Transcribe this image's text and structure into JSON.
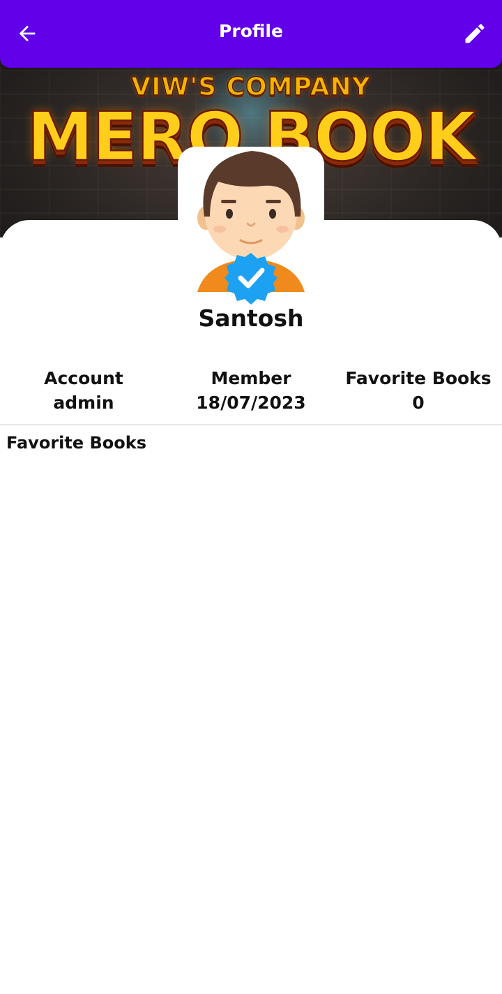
{
  "appbar": {
    "title": "Profile",
    "back_icon": "arrow-back-icon",
    "edit_icon": "pencil-edit-icon",
    "background": "#6200ea"
  },
  "banner": {
    "company": "VIW'S COMPANY",
    "brand": "MERO BOOK"
  },
  "profile": {
    "name": "Santosh",
    "verified_icon": "verified-badge-icon",
    "verified_color": "#1da1f2"
  },
  "stats": [
    {
      "label": "Account",
      "value": "admin"
    },
    {
      "label": "Member",
      "value": "18/07/2023"
    },
    {
      "label": "Favorite Books",
      "value": "0"
    }
  ],
  "favorites": {
    "title": "Favorite Books",
    "items": []
  }
}
